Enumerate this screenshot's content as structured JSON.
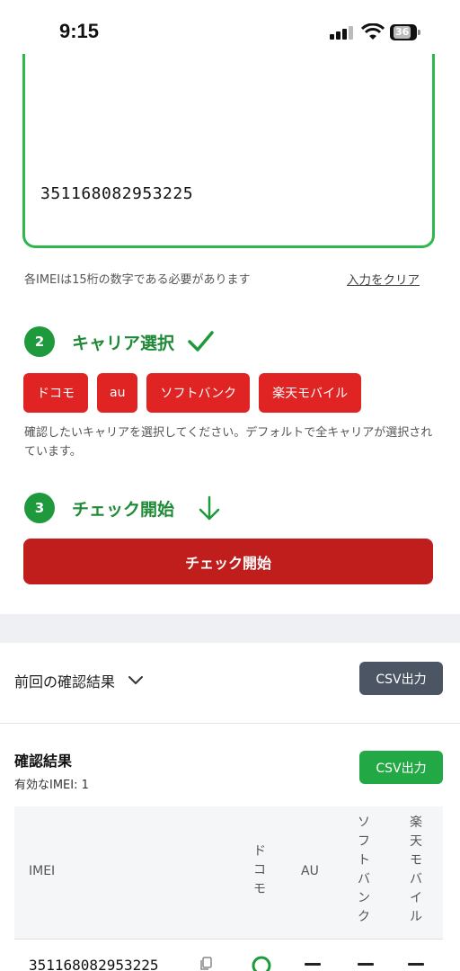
{
  "status_bar": {
    "time": "9:15",
    "battery": "36"
  },
  "imei_input": {
    "value": "351168082953225"
  },
  "hint": {
    "text": "各IMEIは15桁の数字である必要があります",
    "clear_label": "入力をクリア"
  },
  "step2": {
    "number": "2",
    "title": "キャリア選択"
  },
  "carriers": [
    "ドコモ",
    "au",
    "ソフトバンク",
    "楽天モバイル"
  ],
  "carrier_description": "確認したいキャリアを選択してください。デフォルトで全キャリアが選択されています。",
  "step3": {
    "number": "3",
    "title": "チェック開始"
  },
  "start_button": "チェック開始",
  "previous": {
    "title": "前回の確認結果",
    "csv_label": "CSV出力"
  },
  "results": {
    "title": "確認結果",
    "valid_count": "有効なIMEI: 1",
    "csv_label": "CSV出力",
    "headers": {
      "imei": "IMEI",
      "docomo": "ドコモ",
      "au": "AU",
      "softbank": "ソフトバンク",
      "rakuten": "楽天モバイル"
    },
    "rows": [
      {
        "imei": "351168082953225",
        "docomo": "ok",
        "au": "none",
        "softbank": "none",
        "rakuten": "none"
      }
    ]
  },
  "colors": {
    "accent_green": "#1e9a3c",
    "carrier_red": "#e02424",
    "start_red": "#c01d1d",
    "csv_gray": "#4b5563",
    "csv_green": "#22a845"
  }
}
